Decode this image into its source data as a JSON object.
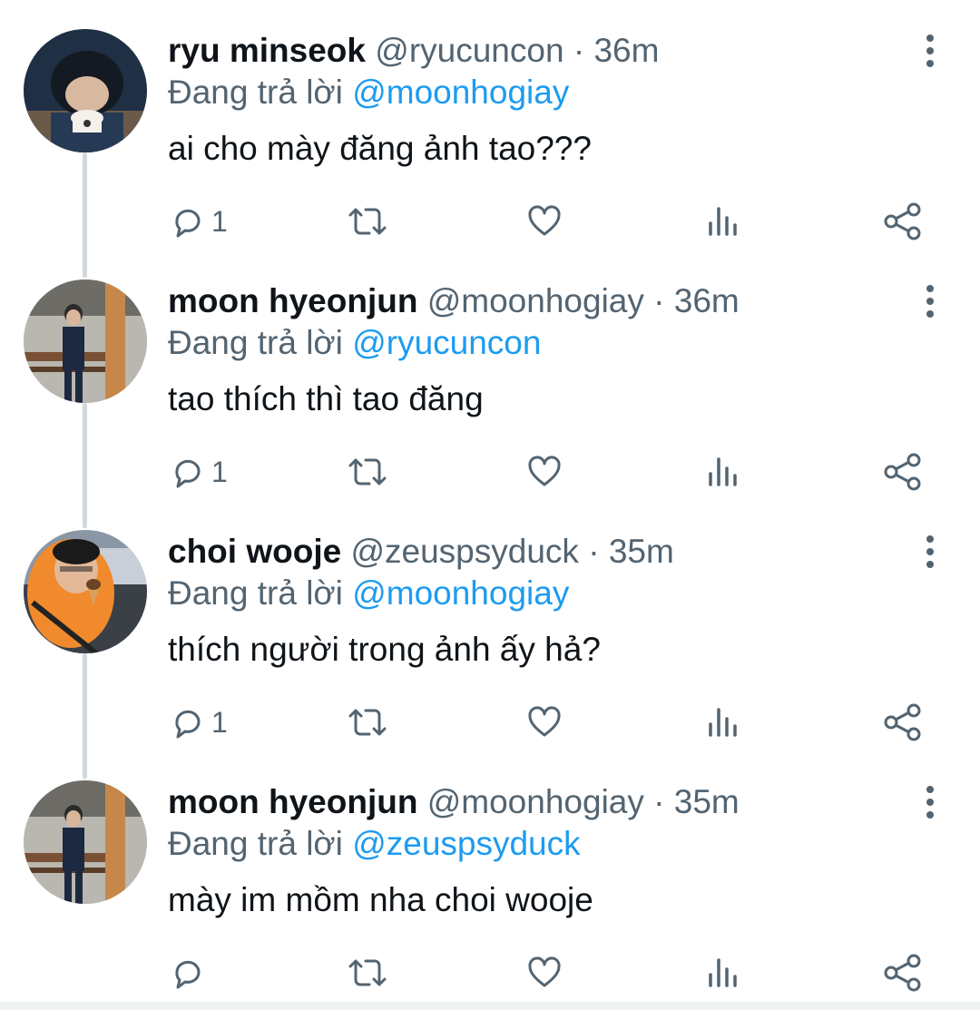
{
  "colors": {
    "text": "#0f1419",
    "muted": "#536471",
    "link": "#1d9bf0",
    "thread_line": "#cfd9de"
  },
  "icons": {
    "reply": "reply-icon",
    "retweet": "retweet-icon",
    "like": "heart-icon",
    "views": "analytics-icon",
    "share": "share-icon",
    "more": "more-vertical-icon"
  },
  "tweets": [
    {
      "name": "ryu minseok",
      "handle": "@ryucuncon",
      "separator": "·",
      "time": "36m",
      "reply_prefix": "Đang trả lời",
      "reply_to": "@moonhogiay",
      "text": "ai cho mày đăng ảnh tao???",
      "reply_count": "1"
    },
    {
      "name": "moon hyeonjun",
      "handle": "@moonhogiay",
      "separator": "·",
      "time": "36m",
      "reply_prefix": "Đang trả lời",
      "reply_to": "@ryucuncon",
      "text": "tao thích thì tao đăng",
      "reply_count": "1"
    },
    {
      "name": "choi wooje",
      "handle": "@zeuspsyduck",
      "separator": "·",
      "time": "35m",
      "reply_prefix": "Đang trả lời",
      "reply_to": "@moonhogiay",
      "text": "thích người trong ảnh ấy hả?",
      "reply_count": "1"
    },
    {
      "name": "moon hyeonjun",
      "handle": "@moonhogiay",
      "separator": "·",
      "time": "35m",
      "reply_prefix": "Đang trả lời",
      "reply_to": "@zeuspsyduck",
      "text": "mày im mồm nha choi wooje",
      "reply_count": ""
    }
  ]
}
